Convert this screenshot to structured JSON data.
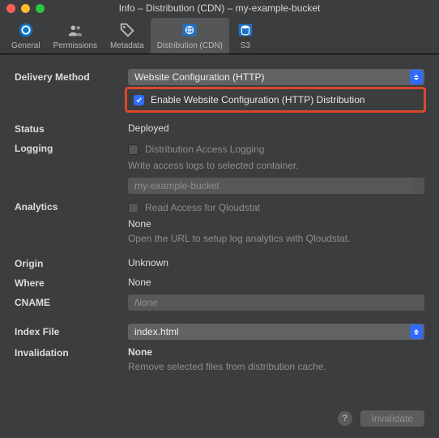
{
  "window": {
    "title": "Info – Distribution (CDN) – my-example-bucket"
  },
  "toolbar": {
    "items": [
      {
        "label": "General"
      },
      {
        "label": "Permissions"
      },
      {
        "label": "Metadata"
      },
      {
        "label": "Distribution (CDN)"
      },
      {
        "label": "S3"
      }
    ]
  },
  "fields": {
    "delivery_method": {
      "label": "Delivery Method",
      "value": "Website Configuration (HTTP)",
      "enable_label": "Enable Website Configuration (HTTP) Distribution"
    },
    "status": {
      "label": "Status",
      "value": "Deployed"
    },
    "logging": {
      "label": "Logging",
      "checkbox_label": "Distribution Access Logging",
      "hint": "Write access logs to selected container.",
      "bucket_value": "my-example-bucket"
    },
    "analytics": {
      "label": "Analytics",
      "checkbox_label": "Read Access for Qloudstat",
      "value": "None",
      "hint": "Open the URL to setup log analytics with Qloudstat."
    },
    "origin": {
      "label": "Origin",
      "value": "Unknown"
    },
    "where": {
      "label": "Where",
      "value": "None"
    },
    "cname": {
      "label": "CNAME",
      "placeholder": "None"
    },
    "index_file": {
      "label": "Index File",
      "value": "index.html"
    },
    "invalidation": {
      "label": "Invalidation",
      "value": "None",
      "hint": "Remove selected files from distribution cache."
    }
  },
  "footer": {
    "invalidate": "Invalidate"
  }
}
